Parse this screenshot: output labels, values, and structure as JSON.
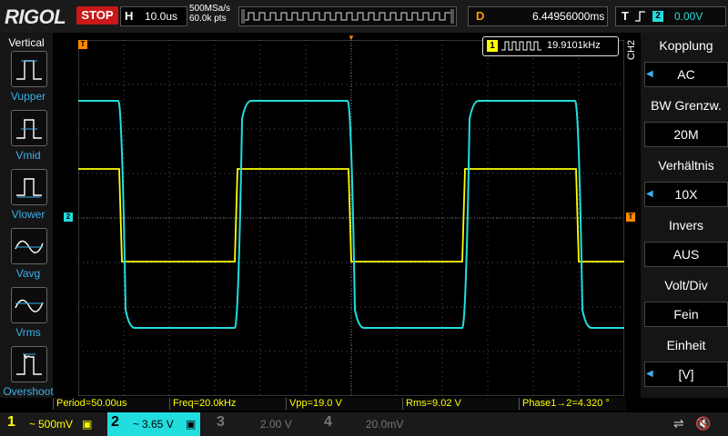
{
  "header": {
    "brand": "RIGOL",
    "run_state": "STOP",
    "h_label": "H",
    "timebase": "10.0us",
    "sample_rate": "500MSa/s",
    "memory_depth": "60.0k pts",
    "d_label": "D",
    "delay": "6.44956000ms",
    "trigger_label": "T",
    "trigger_source": "2",
    "trigger_level": "0.00V"
  },
  "left_menu": {
    "title": "Vertical",
    "items": [
      {
        "label": "Vupper",
        "icon": "vupper-icon"
      },
      {
        "label": "Vmid",
        "icon": "vmid-icon"
      },
      {
        "label": "Vlower",
        "icon": "vlower-icon"
      },
      {
        "label": "Vavg",
        "icon": "vavg-icon"
      },
      {
        "label": "Vrms",
        "icon": "vrms-icon"
      },
      {
        "label": "Overshoot",
        "icon": "overshoot-icon"
      }
    ]
  },
  "right_menu": {
    "channel_tag": "CH2",
    "items": [
      {
        "title": "Kopplung",
        "value": "AC",
        "arrow": true
      },
      {
        "title": "BW Grenzw.",
        "value": "20M",
        "arrow": false
      },
      {
        "title": "Verhältnis",
        "value": "10X",
        "arrow": true
      },
      {
        "title": "Invers",
        "value": "AUS",
        "arrow": false
      },
      {
        "title": "Volt/Div",
        "value": "Fein",
        "arrow": false
      },
      {
        "title": "Einheit",
        "value": "[V]",
        "arrow": true
      }
    ]
  },
  "frequency_counter": {
    "channel": "1",
    "value": "19.9101kHz"
  },
  "markers": {
    "ch1": "1",
    "ch2": "2",
    "trig_pos": "T",
    "trig_level": "T"
  },
  "measurements": [
    "Period=50.00us",
    "Freq=20.0kHz",
    "Vpp=19.0 V",
    "Rms=9.02 V",
    "Phase1→2=4.320 °"
  ],
  "channels": [
    {
      "num": "1",
      "scale": "500mV",
      "active": true,
      "color": "#ffff00"
    },
    {
      "num": "2",
      "scale": "3.65 V",
      "active": true,
      "color": "#22dddd"
    },
    {
      "num": "3",
      "scale": "2.00 V",
      "active": false,
      "color": "#777777"
    },
    {
      "num": "4",
      "scale": "20.0mV",
      "active": false,
      "color": "#777777"
    }
  ],
  "colors": {
    "ch1": "#ffff00",
    "ch2": "#22dddd",
    "trigger": "#ff8800",
    "accent": "#3ab0e8"
  }
}
